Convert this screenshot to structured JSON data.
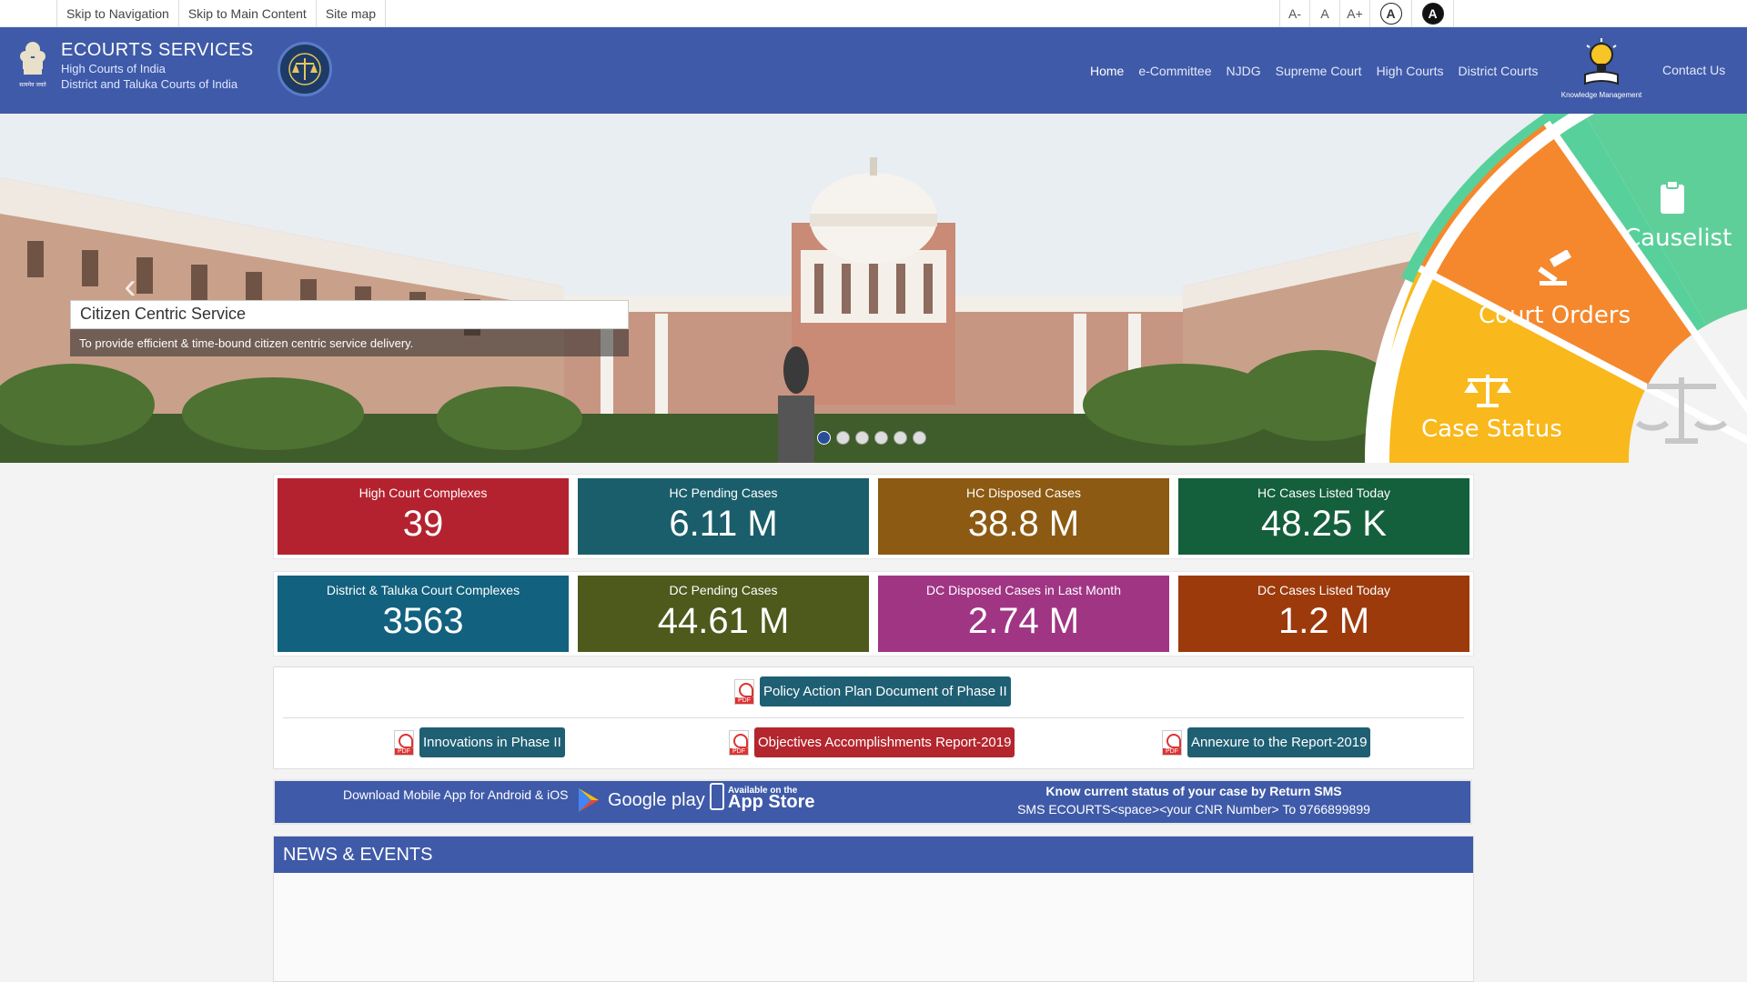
{
  "topbar": {
    "skip_links": [
      "Skip to Navigation",
      "Skip to Main Content",
      "Site map"
    ],
    "font_sizes": [
      "A-",
      "A",
      "A+"
    ],
    "contrast_label": "A"
  },
  "header": {
    "title": "ECOURTS SERVICES",
    "subtitle1": "High Courts of India",
    "subtitle2": "District and Taluka Courts of India",
    "nav": [
      "Home",
      "e-Committee",
      "NJDG",
      "Supreme Court",
      "High Courts",
      "District Courts"
    ],
    "km_label": "Knowledge Management",
    "contact": "Contact Us",
    "emblem_text": "सत्यमेव जयते"
  },
  "hero": {
    "caption_title": "Citizen Centric Service",
    "caption_text": "To provide efficient & time-bound citizen centric service delivery.",
    "slides": 6,
    "active_slide": 0,
    "wheel": [
      "Causelist",
      "Court Orders",
      "Case Status"
    ]
  },
  "stats_row1": [
    {
      "label": "High Court Complexes",
      "value": "39",
      "color": "#b4222f"
    },
    {
      "label": "HC Pending Cases",
      "value": "6.11 M",
      "color": "#1b5e6b"
    },
    {
      "label": "HC Disposed Cases",
      "value": "38.8 M",
      "color": "#8c5a12"
    },
    {
      "label": "HC Cases Listed Today",
      "value": "48.25 K",
      "color": "#145f3c"
    }
  ],
  "stats_row2": [
    {
      "label": "District & Taluka Court Complexes",
      "value": "3563",
      "color": "#12617e"
    },
    {
      "label": "DC Pending Cases",
      "value": "44.61 M",
      "color": "#4d5a1c"
    },
    {
      "label": "DC Disposed Cases in Last Month",
      "value": "2.74 M",
      "color": "#a03584"
    },
    {
      "label": "DC Cases Listed Today",
      "value": "1.2 M",
      "color": "#9c3a0c"
    }
  ],
  "documents": {
    "policy": "Policy Action Plan Document of Phase II",
    "innovations": "Innovations in Phase II",
    "objectives": "Objectives Accomplishments Report-2019",
    "annexure": "Annexure to the Report-2019"
  },
  "app": {
    "download_text": "Download Mobile App for Android & iOS",
    "google_play": "Google play",
    "appstore_small": "Available on the",
    "appstore_big": "App Store",
    "sms_title": "Know current status of your case by Return SMS",
    "sms_text": "SMS ECOURTS<space><your CNR Number> To 9766899899"
  },
  "news": {
    "title": "NEWS & EVENTS"
  },
  "colors": {
    "brand": "#3f5aa8",
    "teal_btn": "#1f5f73",
    "red_btn": "#b3262e"
  }
}
